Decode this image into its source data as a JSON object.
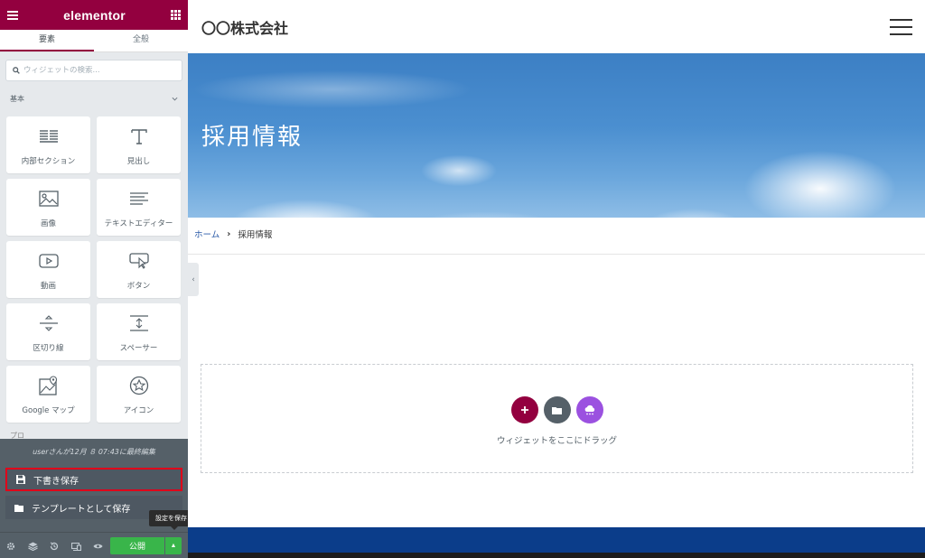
{
  "editor": {
    "logo_text": "elementor",
    "accent_color": "#93003f",
    "tabs": [
      {
        "label": "要素",
        "active": true
      },
      {
        "label": "全般",
        "active": false
      }
    ],
    "search_placeholder": "ウィジェットの検索...",
    "category_label": "基本",
    "widgets": [
      {
        "label": "内部セクション",
        "icon": "inner-section-icon"
      },
      {
        "label": "見出し",
        "icon": "heading-icon"
      },
      {
        "label": "画像",
        "icon": "image-icon"
      },
      {
        "label": "テキストエディター",
        "icon": "text-editor-icon"
      },
      {
        "label": "動画",
        "icon": "video-icon"
      },
      {
        "label": "ボタン",
        "icon": "button-icon"
      },
      {
        "label": "区切り線",
        "icon": "divider-icon"
      },
      {
        "label": "スペーサー",
        "icon": "spacer-icon"
      },
      {
        "label": "Google マップ",
        "icon": "map-icon"
      },
      {
        "label": "アイコン",
        "icon": "star-icon"
      }
    ],
    "next_category_partial": "プロ",
    "save_popup": {
      "last_edit": "userさんが12月 ８ 07:43に最終編集",
      "options": [
        {
          "label": "下書き保存",
          "icon": "save-icon",
          "highlighted": true
        },
        {
          "label": "テンプレートとして保存",
          "icon": "folder-icon",
          "highlighted": false
        }
      ]
    },
    "footer": {
      "icons": [
        "settings-icon",
        "navigator-icon",
        "history-icon",
        "responsive-icon",
        "preview-icon"
      ],
      "publish_label": "公開",
      "publish_color": "#39b54a",
      "tooltip": "設定を保存"
    }
  },
  "preview": {
    "site_title": "〇〇株式会社",
    "hero_title": "採用情報",
    "breadcrumb": {
      "home": "ホーム",
      "separator": "›",
      "current": "採用情報"
    },
    "dropzone": {
      "text": "ウィジェットをここにドラッグ",
      "buttons": [
        {
          "name": "add-section",
          "color": "#93003f"
        },
        {
          "name": "add-template",
          "color": "#556068"
        },
        {
          "name": "kit-library",
          "color": "#9b51e0"
        }
      ]
    },
    "footer_color": "#0b3d8a"
  }
}
